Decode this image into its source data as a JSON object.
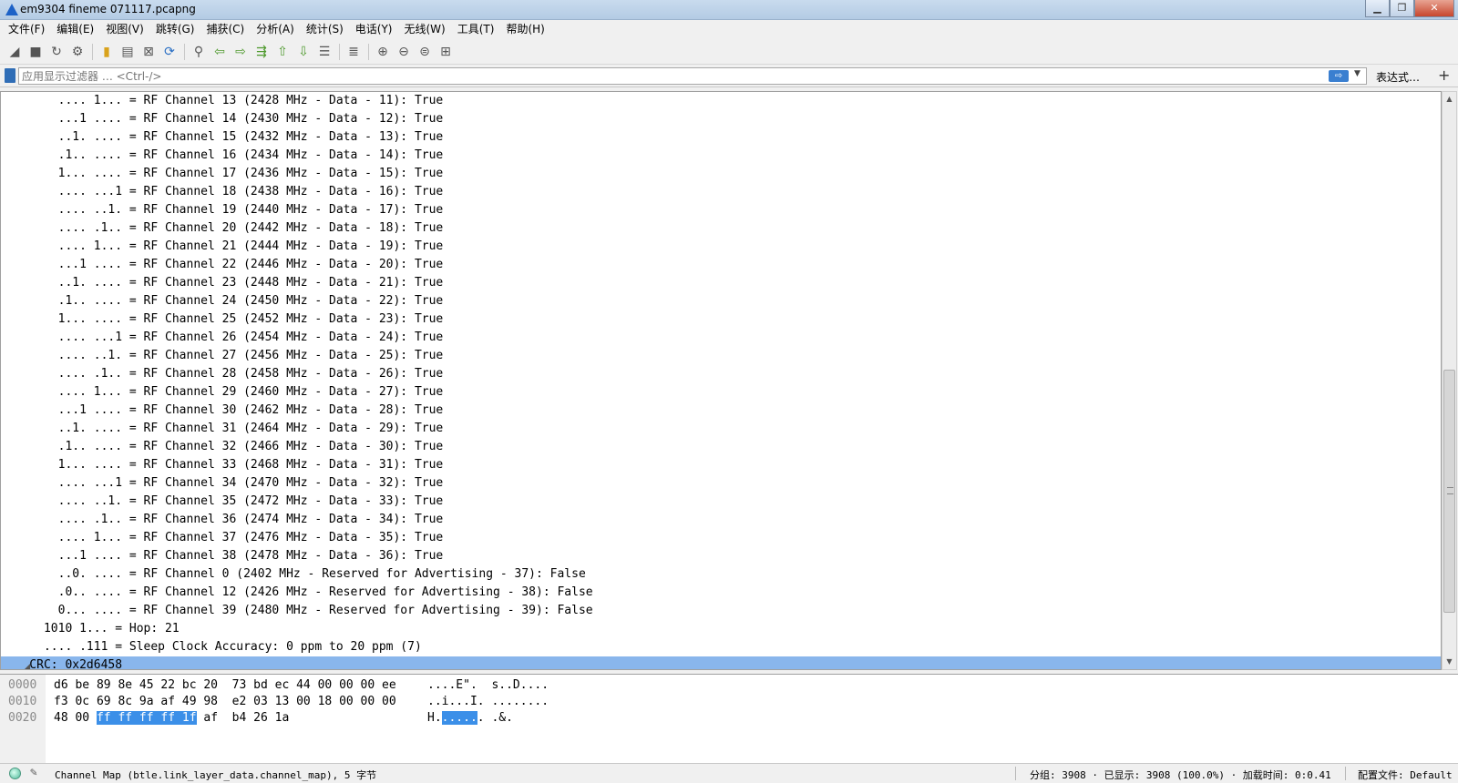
{
  "window": {
    "title": "em9304 fineme 071117.pcapng",
    "controls": [
      "▁",
      "❐",
      "✕"
    ]
  },
  "menu": [
    "文件(F)",
    "编辑(E)",
    "视图(V)",
    "跳转(G)",
    "捕获(C)",
    "分析(A)",
    "统计(S)",
    "电话(Y)",
    "无线(W)",
    "工具(T)",
    "帮助(H)"
  ],
  "filter": {
    "placeholder": "应用显示过滤器 … <Ctrl-/>",
    "apply_glyph": "⇨",
    "dropdown_glyph": "▼",
    "expression_label": "表达式…",
    "add_glyph": "+"
  },
  "details": [
    {
      "text": "        .... 1... = RF Channel 13 (2428 MHz - Data - 11): True"
    },
    {
      "text": "        ...1 .... = RF Channel 14 (2430 MHz - Data - 12): True"
    },
    {
      "text": "        ..1. .... = RF Channel 15 (2432 MHz - Data - 13): True"
    },
    {
      "text": "        .1.. .... = RF Channel 16 (2434 MHz - Data - 14): True"
    },
    {
      "text": "        1... .... = RF Channel 17 (2436 MHz - Data - 15): True"
    },
    {
      "text": "        .... ...1 = RF Channel 18 (2438 MHz - Data - 16): True"
    },
    {
      "text": "        .... ..1. = RF Channel 19 (2440 MHz - Data - 17): True"
    },
    {
      "text": "        .... .1.. = RF Channel 20 (2442 MHz - Data - 18): True"
    },
    {
      "text": "        .... 1... = RF Channel 21 (2444 MHz - Data - 19): True"
    },
    {
      "text": "        ...1 .... = RF Channel 22 (2446 MHz - Data - 20): True"
    },
    {
      "text": "        ..1. .... = RF Channel 23 (2448 MHz - Data - 21): True"
    },
    {
      "text": "        .1.. .... = RF Channel 24 (2450 MHz - Data - 22): True"
    },
    {
      "text": "        1... .... = RF Channel 25 (2452 MHz - Data - 23): True"
    },
    {
      "text": "        .... ...1 = RF Channel 26 (2454 MHz - Data - 24): True"
    },
    {
      "text": "        .... ..1. = RF Channel 27 (2456 MHz - Data - 25): True"
    },
    {
      "text": "        .... .1.. = RF Channel 28 (2458 MHz - Data - 26): True"
    },
    {
      "text": "        .... 1... = RF Channel 29 (2460 MHz - Data - 27): True"
    },
    {
      "text": "        ...1 .... = RF Channel 30 (2462 MHz - Data - 28): True"
    },
    {
      "text": "        ..1. .... = RF Channel 31 (2464 MHz - Data - 29): True"
    },
    {
      "text": "        .1.. .... = RF Channel 32 (2466 MHz - Data - 30): True"
    },
    {
      "text": "        1... .... = RF Channel 33 (2468 MHz - Data - 31): True"
    },
    {
      "text": "        .... ...1 = RF Channel 34 (2470 MHz - Data - 32): True"
    },
    {
      "text": "        .... ..1. = RF Channel 35 (2472 MHz - Data - 33): True"
    },
    {
      "text": "        .... .1.. = RF Channel 36 (2474 MHz - Data - 34): True"
    },
    {
      "text": "        .... 1... = RF Channel 37 (2476 MHz - Data - 35): True"
    },
    {
      "text": "        ...1 .... = RF Channel 38 (2478 MHz - Data - 36): True"
    },
    {
      "text": "        ..0. .... = RF Channel 0 (2402 MHz - Reserved for Advertising - 37): False"
    },
    {
      "text": "        .0.. .... = RF Channel 12 (2426 MHz - Reserved for Advertising - 38): False"
    },
    {
      "text": "        0... .... = RF Channel 39 (2480 MHz - Reserved for Advertising - 39): False"
    },
    {
      "text": "      1010 1... = Hop: 21"
    },
    {
      "text": "      .... .111 = Sleep Clock Accuracy: 0 ppm to 20 ppm (7)"
    },
    {
      "text": "    CRC: 0x2d6458",
      "selected": true
    }
  ],
  "bytes": {
    "rows": [
      {
        "offset": "0000",
        "hex_pre": "d6 be 89 8e 45 22 bc 20  73 bd ec 44 00 00 00 ee",
        "hex_hl": "",
        "hex_post": "",
        "ascii_pre": "....E\".  s..D....",
        "ascii_hl": "",
        "ascii_post": ""
      },
      {
        "offset": "0010",
        "hex_pre": "f3 0c 69 8c 9a af 49 98  e2 03 13 00 18 00 00 00",
        "hex_hl": "",
        "hex_post": "",
        "ascii_pre": "..i...I. ........",
        "ascii_hl": "",
        "ascii_post": ""
      },
      {
        "offset": "0020",
        "hex_pre": "48 00 ",
        "hex_hl": "ff ff ff ff 1f",
        "hex_post": " af  b4 26 1a",
        "ascii_pre": "H.",
        "ascii_hl": ".....",
        "ascii_post": ". .&."
      }
    ]
  },
  "status": {
    "field_info": "Channel Map (btle.link_layer_data.channel_map), 5 字节",
    "packets": "分组: 3908 · 已显示: 3908 (100.0%) · 加载时间: 0:0.41",
    "profile": "配置文件: Default"
  }
}
